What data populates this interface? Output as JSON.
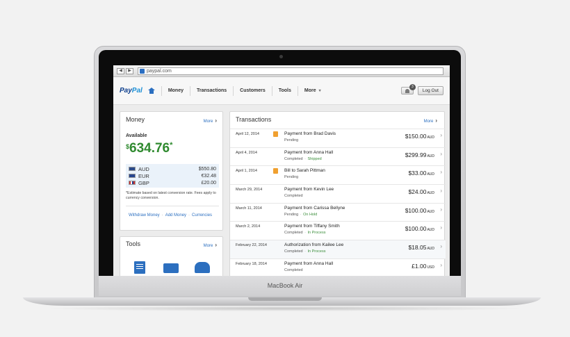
{
  "device": {
    "label": "MacBook Air"
  },
  "browser": {
    "url": "paypal.com",
    "back": "◀",
    "forward": "▶"
  },
  "header": {
    "logo_pay": "Pay",
    "logo_pal": "Pal",
    "nav": [
      "Money",
      "Transactions",
      "Customers",
      "Tools",
      "More"
    ],
    "notifications_count": "3",
    "logout_label": "Log Out"
  },
  "money": {
    "title": "Money",
    "more_label": "More",
    "available_label": "Available",
    "balance_symbol": "$",
    "balance": "634.76",
    "balance_note": "*",
    "currencies": [
      {
        "code": "AUD",
        "amount": "$550.80"
      },
      {
        "code": "EUR",
        "amount": "€32.48"
      },
      {
        "code": "GBP",
        "amount": "£20.00"
      }
    ],
    "estimate_note": "*Estimate based on latest conversion rate. Fees apply to currency conversion.",
    "links": [
      "Withdraw Money",
      "Add Money",
      "Currencies"
    ]
  },
  "tools": {
    "title": "Tools",
    "more_label": "More"
  },
  "transactions": {
    "title": "Transactions",
    "more_label": "More",
    "rows": [
      {
        "date": "April 12, 2014",
        "flag": true,
        "desc": "Payment from Brad Davis",
        "status": "Pending",
        "substatus": "",
        "amount": "$150.00",
        "ccy": "AUD"
      },
      {
        "date": "April 4, 2014",
        "flag": false,
        "desc": "Payment from Anna Hall",
        "status": "Completed",
        "substatus": "Shipped",
        "amount": "$299.99",
        "ccy": "AUD"
      },
      {
        "date": "April 1, 2014",
        "flag": true,
        "desc": "Bill to Sarah Pittman",
        "status": "Pending",
        "substatus": "",
        "amount": "$33.00",
        "ccy": "AUD"
      },
      {
        "date": "March 29, 2014",
        "flag": false,
        "desc": "Payment from Kevin Lee",
        "status": "Completed",
        "substatus": "",
        "amount": "$24.00",
        "ccy": "AUD"
      },
      {
        "date": "March 11, 2014",
        "flag": false,
        "desc": "Payment from Carissa Bellyne",
        "status": "Pending",
        "substatus": "On Hold",
        "amount": "$100.00",
        "ccy": "AUD"
      },
      {
        "date": "March 2, 2014",
        "flag": false,
        "desc": "Payment from Tiffany Smith",
        "status": "Completed",
        "substatus": "In Process",
        "amount": "$100.00",
        "ccy": "AUD"
      },
      {
        "date": "February 22, 2014",
        "flag": false,
        "desc": "Authorization from Kailee Lee",
        "status": "Completed",
        "substatus": "In Process",
        "amount": "$18.05",
        "ccy": "AUD"
      },
      {
        "date": "February 18, 2014",
        "flag": false,
        "desc": "Payment from Anna Hall",
        "status": "Completed",
        "substatus": "",
        "amount": "£1.00",
        "ccy": "USD"
      }
    ]
  }
}
